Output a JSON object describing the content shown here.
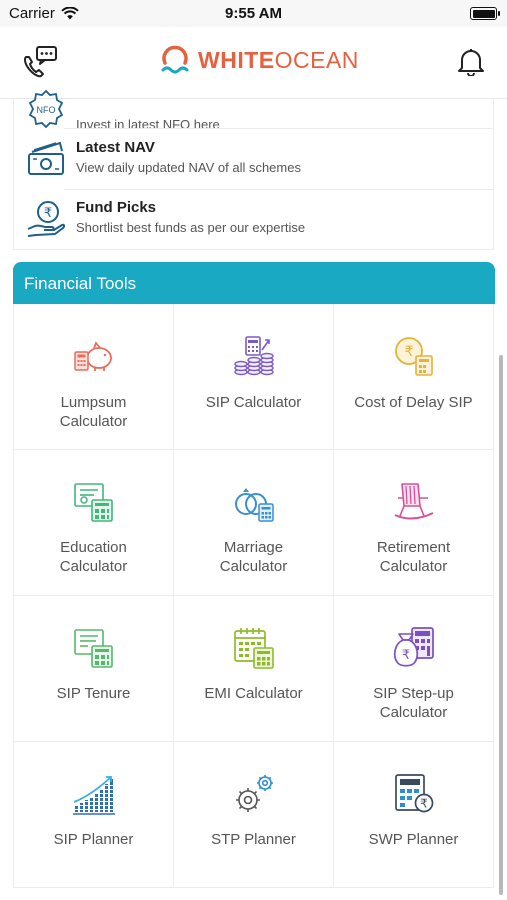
{
  "status_bar": {
    "carrier": "Carrier",
    "time": "9:55 AM"
  },
  "header": {
    "brand_white": "WHITE",
    "brand_ocean": "OCEAN",
    "call_icon": "phone-chat-icon",
    "bell_icon": "bell-icon"
  },
  "list": [
    {
      "title": "",
      "subtitle": "Invest in latest NFO here",
      "icon": "nfo-badge-icon",
      "icon_text": "NFO"
    },
    {
      "title": "Latest NAV",
      "subtitle": "View daily updated NAV of all schemes",
      "icon": "banknote-icon"
    },
    {
      "title": "Fund Picks",
      "subtitle": "Shortlist best funds as per our expertise",
      "icon": "hand-rupee-icon"
    }
  ],
  "tools": {
    "title": "Financial Tools",
    "items": [
      {
        "line1": "Lumpsum",
        "line2": "Calculator",
        "icon": "piggy-bank-calculator-icon"
      },
      {
        "line1": "SIP Calculator",
        "line2": "",
        "icon": "coin-stack-icon"
      },
      {
        "line1": "Cost of Delay SIP",
        "line2": "",
        "icon": "rupee-clock-calculator-icon"
      },
      {
        "line1": "Education",
        "line2": "Calculator",
        "icon": "certificate-calculator-icon"
      },
      {
        "line1": "Marriage",
        "line2": "Calculator",
        "icon": "rings-calculator-icon"
      },
      {
        "line1": "Retirement",
        "line2": "Calculator",
        "icon": "rocking-chair-icon"
      },
      {
        "line1": "SIP Tenure",
        "line2": "",
        "icon": "document-calculator-icon"
      },
      {
        "line1": "EMI Calculator",
        "line2": "",
        "icon": "calendar-calculator-icon"
      },
      {
        "line1": "SIP Step-up",
        "line2": "Calculator",
        "icon": "money-bag-calculator-icon"
      },
      {
        "line1": "SIP Planner",
        "line2": "",
        "icon": "growth-chart-icon"
      },
      {
        "line1": "STP Planner",
        "line2": "",
        "icon": "gears-icon"
      },
      {
        "line1": "SWP Planner",
        "line2": "",
        "icon": "calculator-rupee-icon"
      }
    ]
  },
  "colors": {
    "accent": "#19a9c2",
    "brand": "#e7603f"
  }
}
